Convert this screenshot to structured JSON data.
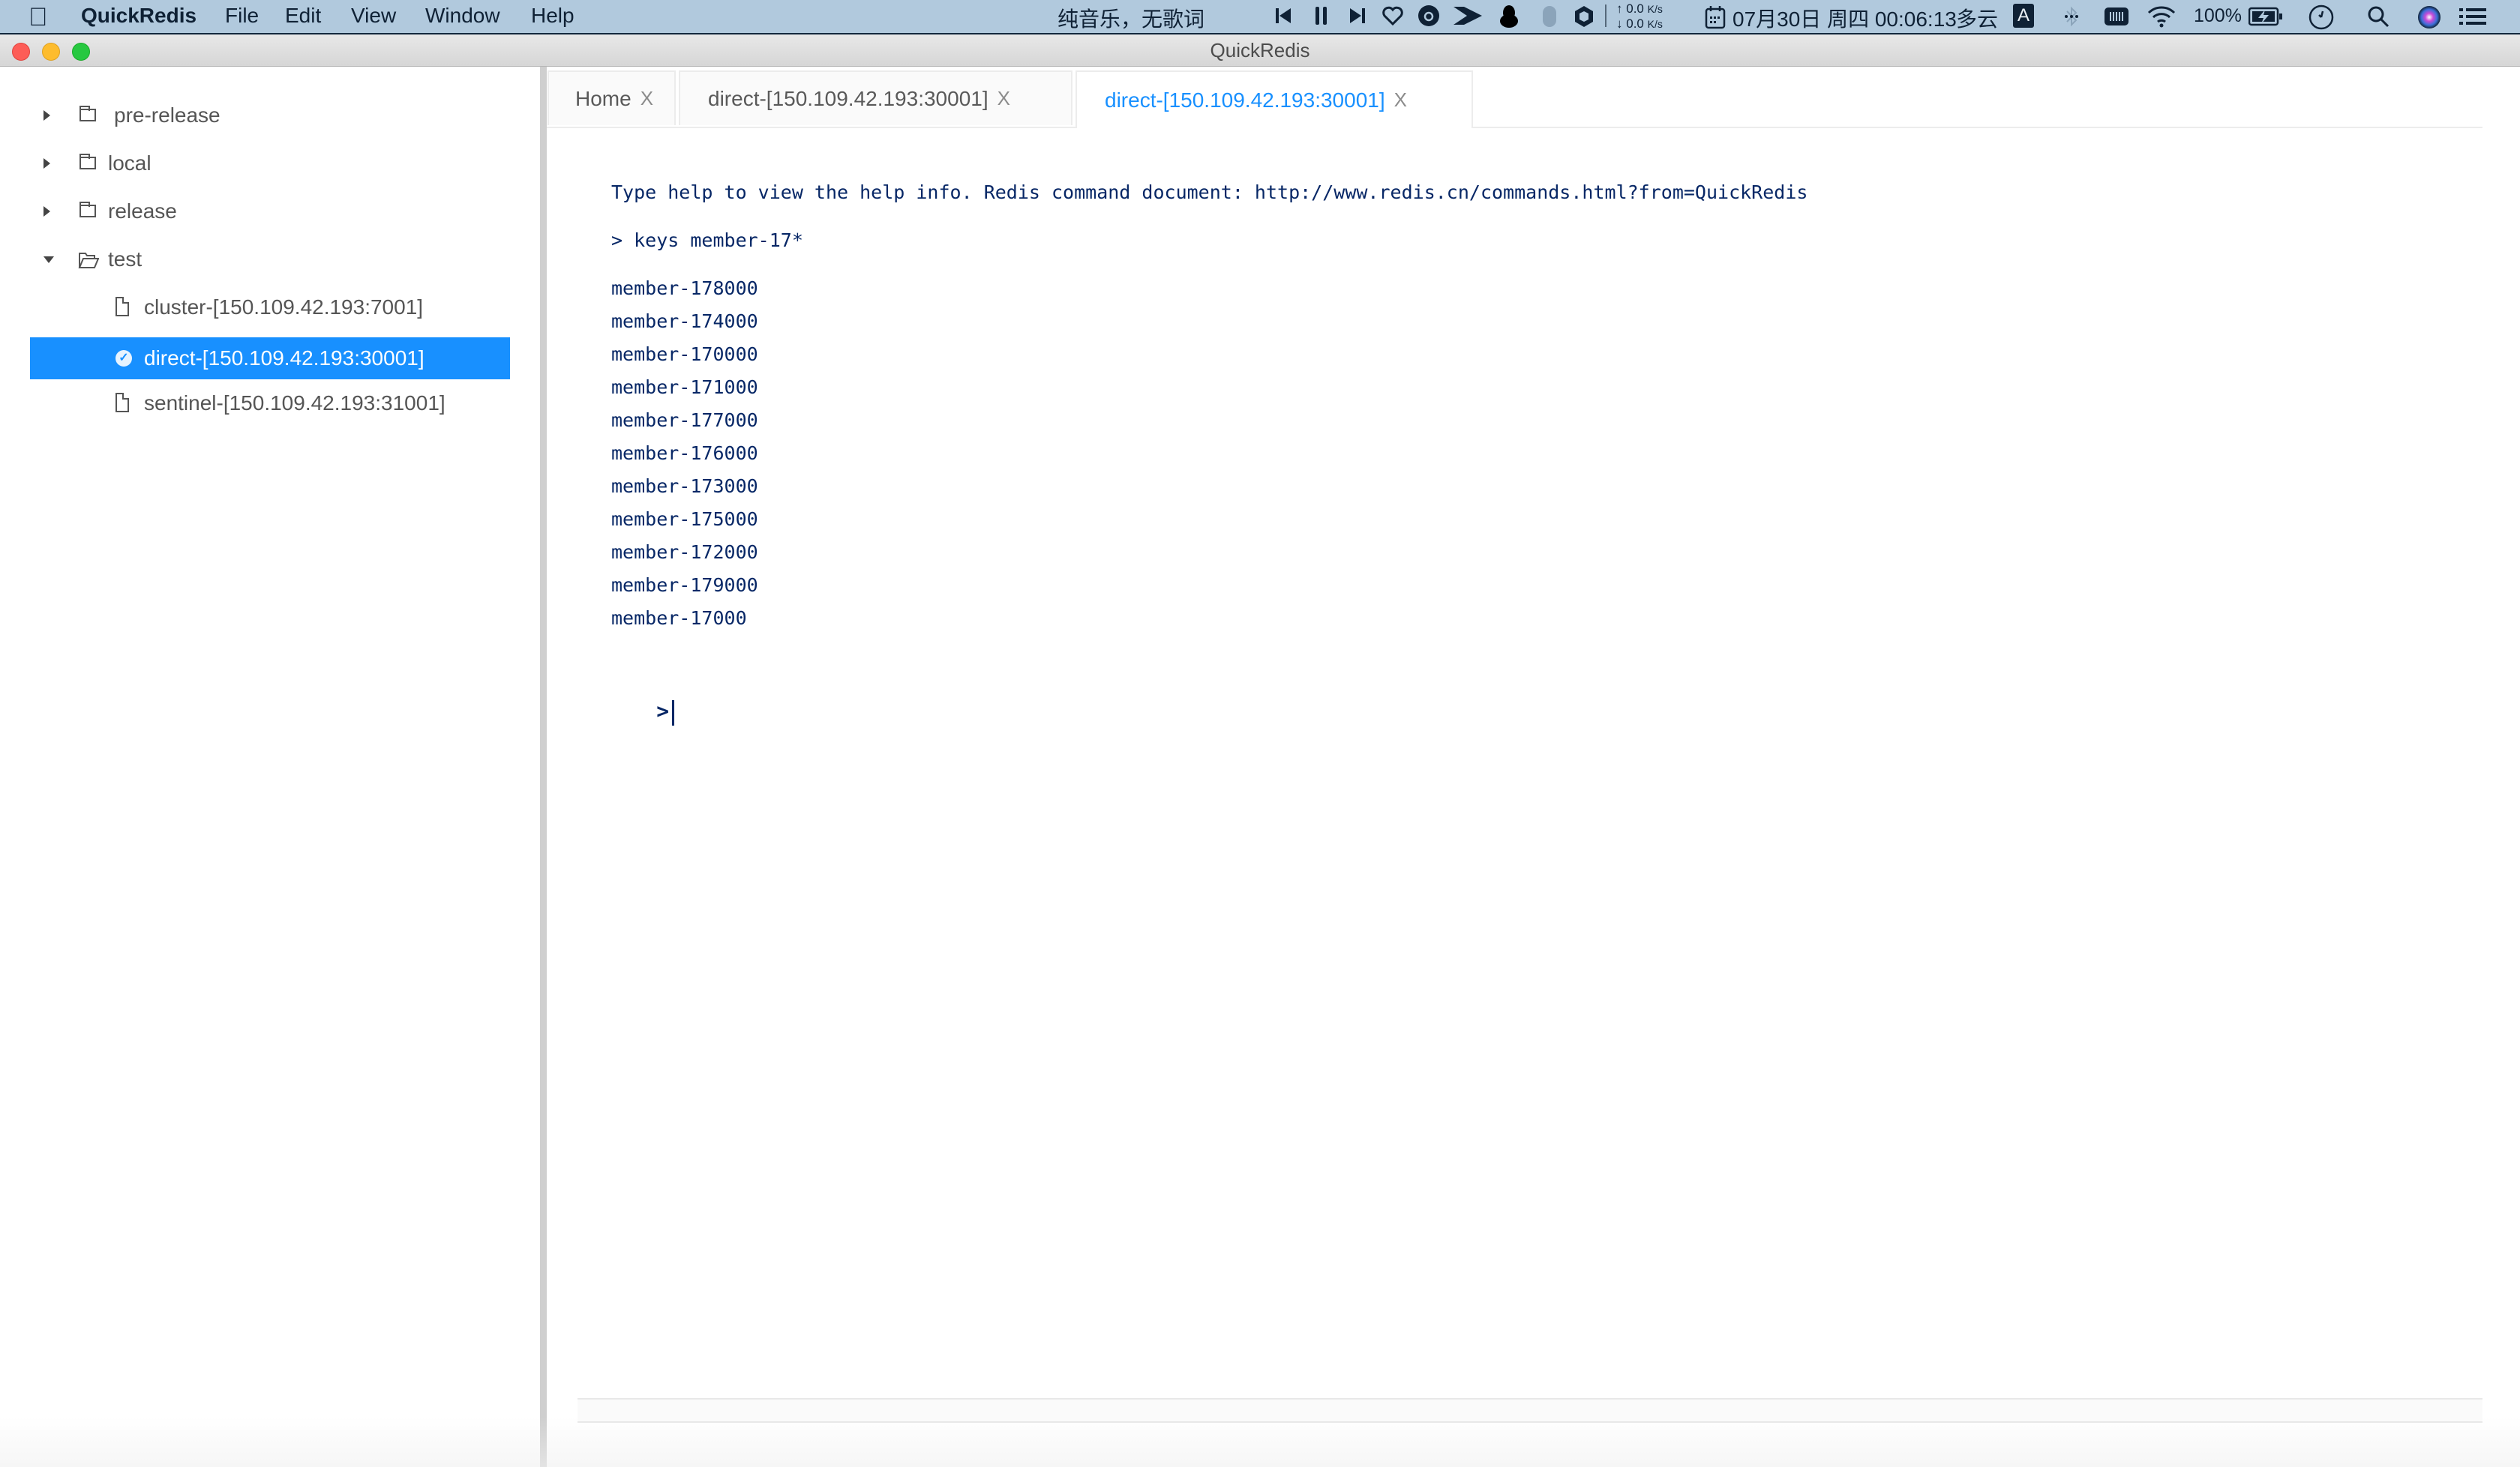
{
  "menubar": {
    "app_name": "QuickRedis",
    "menus": [
      "File",
      "Edit",
      "View",
      "Window",
      "Help"
    ],
    "now_playing": "纯音乐，无歌词",
    "net_up": "0.0",
    "net_down": "0.0",
    "net_unit": "K/s",
    "datetime": "07月30日 周四 00:06:13",
    "weather": "多云",
    "input_method": "A",
    "battery": "100%",
    "icons": [
      "apple-icon",
      "previous-track-icon",
      "pause-icon",
      "next-track-icon",
      "heart-icon",
      "netease-music-icon",
      "arrow-app-icon",
      "qq-penguin-icon",
      "mouse-icon",
      "hexagon-icon",
      "calendar-icon",
      "input-method-icon",
      "bluetooth-icon",
      "memory-icon",
      "wifi-icon",
      "battery-charging-icon",
      "clock-icon",
      "spotlight-search-icon",
      "siri-icon",
      "notification-center-icon"
    ]
  },
  "window": {
    "title": "QuickRedis"
  },
  "sidebar": {
    "tree": [
      {
        "label": "pre-release",
        "type": "folder",
        "expanded": false
      },
      {
        "label": "local",
        "type": "folder",
        "expanded": false
      },
      {
        "label": "release",
        "type": "folder",
        "expanded": false
      },
      {
        "label": "test",
        "type": "folder",
        "expanded": true
      },
      {
        "label": "cluster-[150.109.42.193:7001]",
        "type": "connection",
        "selected": false
      },
      {
        "label": "direct-[150.109.42.193:30001]",
        "type": "connection",
        "selected": true
      },
      {
        "label": "sentinel-[150.109.42.193:31001]",
        "type": "connection",
        "selected": false
      }
    ]
  },
  "tabs": [
    {
      "label": "Home",
      "close": "X",
      "active": false
    },
    {
      "label": "direct-[150.109.42.193:30001]",
      "close": "X",
      "active": false
    },
    {
      "label": "direct-[150.109.42.193:30001]",
      "close": "X",
      "active": true
    }
  ],
  "console": {
    "help_line": "Type help to view the help info. Redis command document: http://www.redis.cn/commands.html?from=QuickRedis",
    "command": "> keys member-17*",
    "results": [
      "member-178000",
      "member-174000",
      "member-170000",
      "member-171000",
      "member-177000",
      "member-176000",
      "member-173000",
      "member-175000",
      "member-172000",
      "member-179000",
      "member-17000"
    ],
    "prompt": ">",
    "input_value": ""
  },
  "colors": {
    "accent": "#1890ff",
    "console_text": "#072766",
    "menubar_bg": "#b1c9dd"
  }
}
